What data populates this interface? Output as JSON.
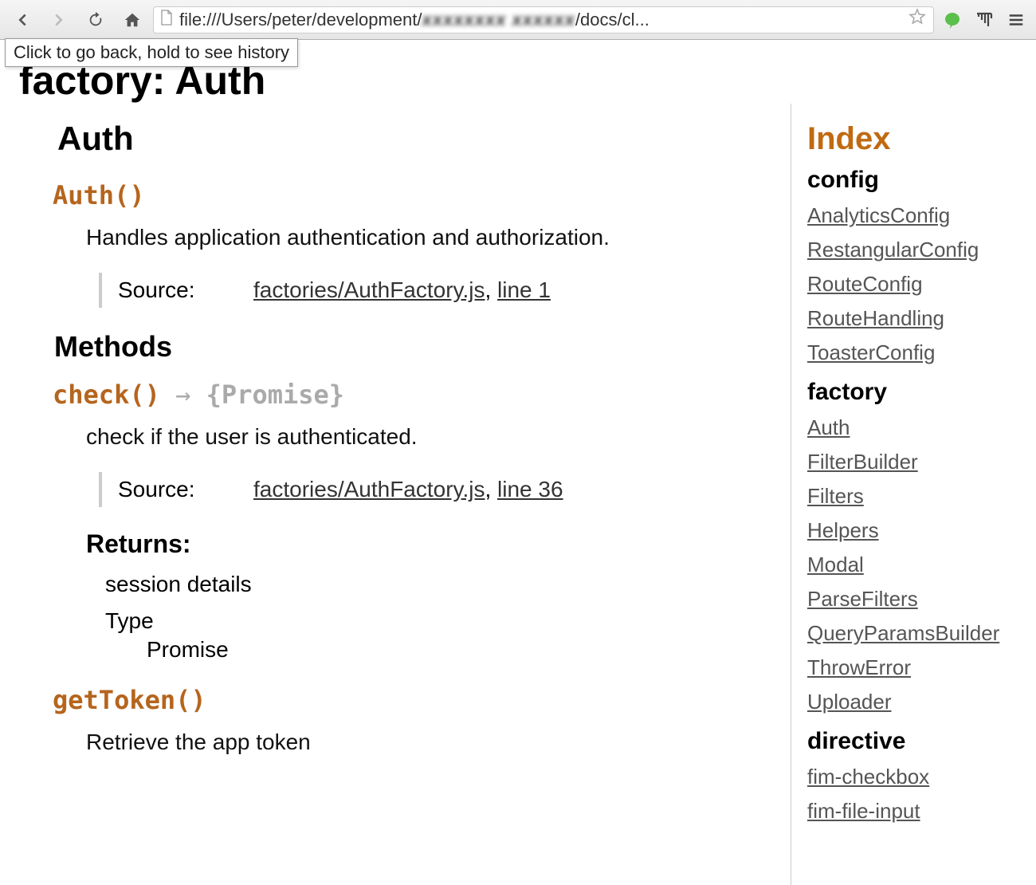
{
  "browser": {
    "tooltip": "Click to go back, hold to see history",
    "url_prefix": "file:///Users/peter/development/",
    "url_obscured": "xxxxxxxx xxxxxx",
    "url_suffix": "/docs/cl..."
  },
  "page": {
    "title": "factory: Auth",
    "class_name": "Auth",
    "constructor": {
      "sig": "Auth()",
      "desc": "Handles application authentication and authorization.",
      "source_label": "Source:",
      "source_file": "factories/AuthFactory.js",
      "source_line": "line 1"
    },
    "methods_heading": "Methods",
    "methods": [
      {
        "sig": "check()",
        "arrow": " → ",
        "ret_sig": "{Promise}",
        "desc": "check if the user is authenticated.",
        "source_label": "Source:",
        "source_file": "factories/AuthFactory.js",
        "source_line": "line 36",
        "returns_heading": "Returns:",
        "returns_desc": "session details",
        "type_label": "Type",
        "type_val": "Promise"
      },
      {
        "sig": "getToken()",
        "desc": "Retrieve the app token"
      }
    ]
  },
  "sidebar": {
    "title": "Index",
    "sections": [
      {
        "name": "config",
        "items": [
          "AnalyticsConfig",
          "RestangularConfig",
          "RouteConfig",
          "RouteHandling",
          "ToasterConfig"
        ]
      },
      {
        "name": "factory",
        "items": [
          "Auth",
          "FilterBuilder",
          "Filters",
          "Helpers",
          "Modal",
          "ParseFilters",
          "QueryParamsBuilder",
          "ThrowError",
          "Uploader"
        ]
      },
      {
        "name": "directive",
        "items": [
          "fim-checkbox",
          "fim-file-input"
        ]
      }
    ]
  }
}
